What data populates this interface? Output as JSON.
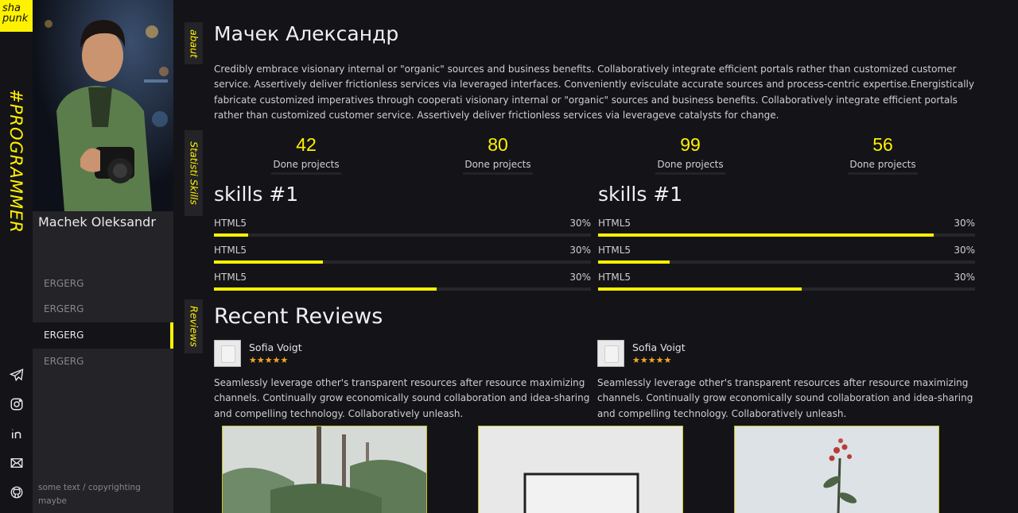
{
  "logo": {
    "line1": "sha",
    "line2": "punk"
  },
  "tagline": "#PROGRAMMER",
  "profile": {
    "name": "Machek Oleksandr"
  },
  "menu": [
    {
      "label": "ERGERG",
      "active": false
    },
    {
      "label": "ERGERG",
      "active": false
    },
    {
      "label": "ERGERG",
      "active": true
    },
    {
      "label": "ERGERG",
      "active": false
    }
  ],
  "footer": {
    "copyright": "some text / copyrighting maybe"
  },
  "social": [
    "telegram-icon",
    "instagram-icon",
    "linkedin-icon",
    "mail-icon",
    "github-icon"
  ],
  "tabs": {
    "about": "abaut",
    "stats_skills": "Statisti  Skills",
    "reviews": "Reviews"
  },
  "about": {
    "title": "Мачек Александр",
    "text": "Credibly embrace visionary internal or \"organic\" sources and business benefits. Collaboratively integrate efficient portals rather than customized customer service. Assertively deliver frictionless services via leveraged interfaces. Conveniently evisculate accurate sources and process-centric expertise.Energistically fabricate customized imperatives through cooperati visionary internal or \"organic\" sources and business benefits. Collaboratively integrate efficient portals rather than customized customer service. Assertively deliver frictionless services via leveragеve catalysts for change."
  },
  "stats": [
    {
      "value": "42",
      "label": "Done projects"
    },
    {
      "value": "80",
      "label": "Done projects"
    },
    {
      "value": "99",
      "label": "Done projects"
    },
    {
      "value": "56",
      "label": "Done projects"
    }
  ],
  "skills": [
    {
      "title": "skills #1",
      "items": [
        {
          "name": "HTML5",
          "percent": "30%",
          "fill": 0.09
        },
        {
          "name": "HTML5",
          "percent": "30%",
          "fill": 0.29
        },
        {
          "name": "HTML5",
          "percent": "30%",
          "fill": 0.59
        }
      ]
    },
    {
      "title": "skills #1",
      "items": [
        {
          "name": "HTML5",
          "percent": "30%",
          "fill": 0.89
        },
        {
          "name": "HTML5",
          "percent": "30%",
          "fill": 0.19
        },
        {
          "name": "HTML5",
          "percent": "30%",
          "fill": 0.54
        }
      ]
    }
  ],
  "reviews": {
    "title": "Recent Reviews",
    "items": [
      {
        "name": "Sofia Voigt",
        "stars": "★★★★★",
        "text": "Seamlessly leverage other's transparent resources after resource maximizing channels. Continually grow economically sound collaboration and idea-sharing and compelling technology. Collaboratively unleash."
      },
      {
        "name": "Sofia Voigt",
        "stars": "★★★★★",
        "text": "Seamlessly leverage other's transparent resources after resource maximizing channels. Continually grow economically sound collaboration and idea-sharing and compelling technology. Collaboratively unleash."
      }
    ]
  },
  "colors": {
    "accent": "#fff200",
    "bg": "#141418",
    "panel": "#232328",
    "star": "#f5a623"
  }
}
